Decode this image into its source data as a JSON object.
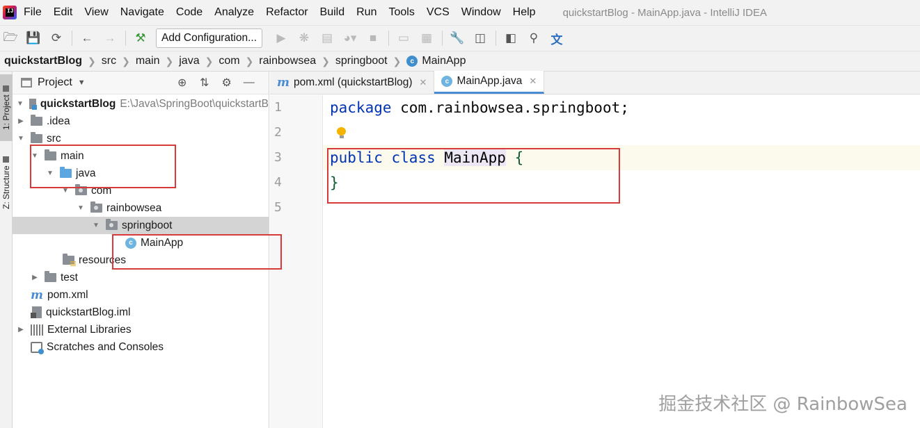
{
  "menubar": {
    "items": [
      "File",
      "Edit",
      "View",
      "Navigate",
      "Code",
      "Analyze",
      "Refactor",
      "Build",
      "Run",
      "Tools",
      "VCS",
      "Window",
      "Help"
    ],
    "window_title": "quickstartBlog - MainApp.java - IntelliJ IDEA"
  },
  "toolbar": {
    "add_configuration_label": "Add Configuration...",
    "icons": [
      "folder-open-icon",
      "save-icon",
      "sync-icon",
      "back-arrow-icon",
      "forward-arrow-icon",
      "build-hammer-icon",
      "run-icon",
      "debug-icon",
      "coverage-icon",
      "profile-icon",
      "stop-icon",
      "device-icon",
      "layout-icon",
      "wrench-icon",
      "project-structure-icon",
      "terminal-icon",
      "search-icon",
      "translate-icon"
    ]
  },
  "breadcrumb": {
    "items": [
      "quickstartBlog",
      "src",
      "main",
      "java",
      "com",
      "rainbowsea",
      "springboot",
      "MainApp"
    ]
  },
  "left_strip": {
    "project_tab": "1: Project",
    "structure_tab": "Z: Structure"
  },
  "project_panel": {
    "title": "Project",
    "tree": {
      "root": {
        "label": "quickstartBlog",
        "path": "E:\\Java\\SpringBoot\\quickstartB"
      },
      "idea": ".idea",
      "src": "src",
      "main": "main",
      "java": "java",
      "com": "com",
      "rainbowsea": "rainbowsea",
      "springboot": "springboot",
      "mainapp": "MainApp",
      "resources": "resources",
      "test": "test",
      "pom": "pom.xml",
      "iml": "quickstartBlog.iml",
      "external_libraries": "External Libraries",
      "scratches": "Scratches and Consoles"
    }
  },
  "editor": {
    "tabs": [
      {
        "label": "pom.xml (quickstartBlog)",
        "active": false
      },
      {
        "label": "MainApp.java",
        "active": true
      }
    ],
    "line_numbers": [
      "1",
      "2",
      "3",
      "4",
      "5"
    ],
    "code": {
      "line1_kw": "package",
      "line1_rest": " com.rainbowsea.springboot;",
      "line3_kw1": "public",
      "line3_kw2": "class",
      "line3_cls": "MainApp",
      "line3_brace": "{",
      "line4_brace": "}"
    }
  },
  "watermark": "掘金技术社区 @ RainbowSea",
  "colors": {
    "keyword": "#0033b3",
    "annotation_red": "#d83a3a",
    "selection": "#d4d4d4",
    "accent_blue": "#4a8bd6"
  }
}
